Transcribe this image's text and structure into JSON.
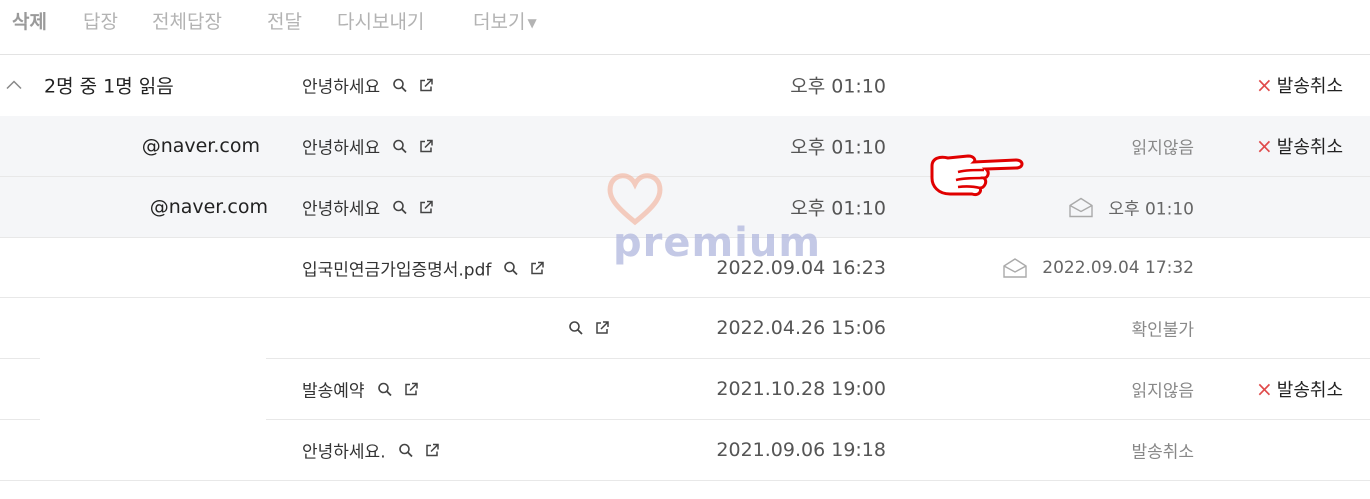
{
  "toolbar": {
    "delete": "삭제",
    "reply": "답장",
    "reply_all": "전체답장",
    "forward": "전달",
    "resend": "다시보내기",
    "more": "더보기"
  },
  "summary": {
    "read_count": "2명 중 1명 읽음",
    "subject": "안녕하세요",
    "time": "오후 01:10",
    "cancel": "발송취소"
  },
  "rows": [
    {
      "recipient": "@naver.com",
      "subject": "안녕하세요",
      "time": "오후 01:10",
      "status": "읽지않음",
      "cancel": "발송취소"
    },
    {
      "recipient": "@naver.com",
      "subject": "안녕하세요",
      "time": "오후 01:10",
      "status": "오후 01:10"
    },
    {
      "recipient": "",
      "subject": "입국민연금가입증명서.pdf",
      "time": "2022.09.04 16:23",
      "status": "2022.09.04 17:32"
    },
    {
      "recipient": "",
      "subject": "",
      "time": "2022.04.26 15:06",
      "status": "확인불가"
    },
    {
      "recipient": "",
      "subject": "발송예약",
      "time": "2021.10.28 19:00",
      "status": "읽지않음",
      "cancel": "발송취소"
    },
    {
      "recipient": "",
      "subject": "안녕하세요.",
      "time": "2021.09.06 19:18",
      "status": "발송취소"
    }
  ],
  "watermark": {
    "text": "premium"
  },
  "colors": {
    "cancel_x": "#e04b4b",
    "selected_row": "#f5f6f8",
    "toolbar_text": "#b3b3b3"
  }
}
